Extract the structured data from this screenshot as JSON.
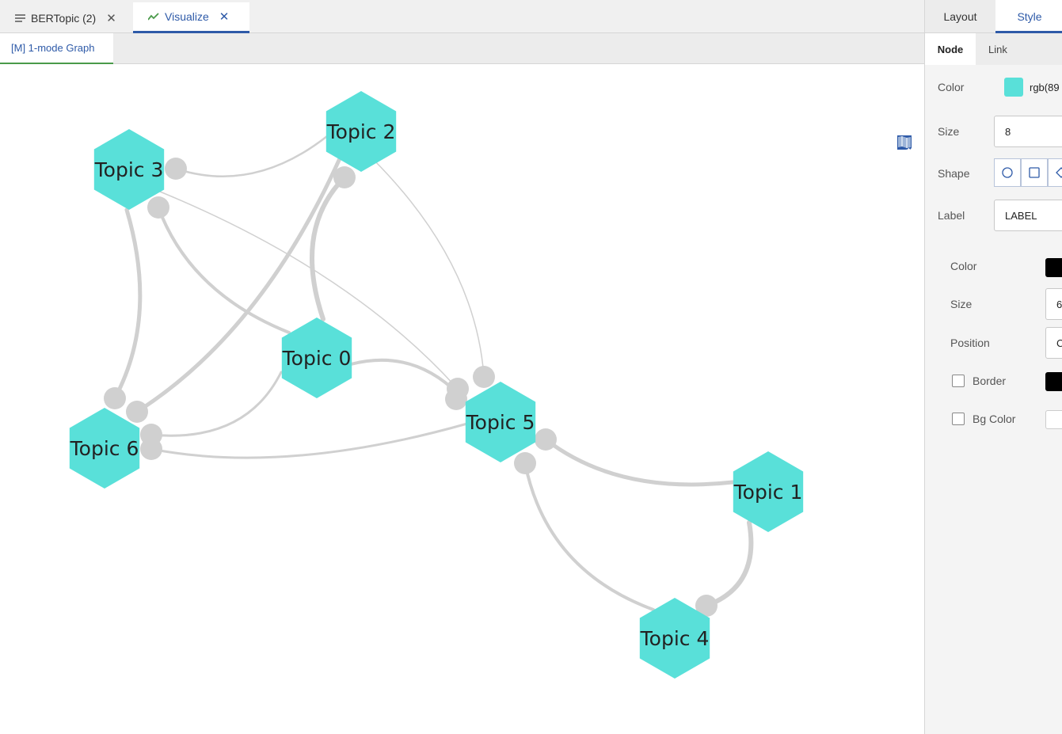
{
  "tabs": [
    {
      "label": "BERTopic (2)",
      "icon": "list-icon"
    },
    {
      "label": "Visualize",
      "icon": "trend-icon"
    }
  ],
  "subtab": {
    "label": "[M] 1-mode Graph"
  },
  "graph": {
    "node_color": "#59e0d9",
    "nodes": [
      "Topic 2",
      "Topic 3",
      "Topic 0",
      "Topic 5",
      "Topic 6",
      "Topic 1",
      "Topic 4"
    ]
  },
  "toolbar": {
    "icons": [
      "fit-screen-icon",
      "zoom-in-icon",
      "zoom-out-icon",
      "text-icon",
      "text-color-icon",
      "arrow-right-icon",
      "swap-horizontal-icon",
      "swap-vertical-icon",
      "copy-icon",
      "image-icon",
      "map-icon"
    ]
  },
  "panel": {
    "tabs": {
      "layout": "Layout",
      "style": "Style"
    },
    "subtabs": {
      "node": "Node",
      "link": "Link"
    },
    "color_label": "Color",
    "color_value": "rgb(89",
    "size_label": "Size",
    "size_value": "8",
    "shape_label": "Shape",
    "label_label": "Label",
    "label_value": "LABEL",
    "label_section": {
      "color_label": "Color",
      "size_label": "Size",
      "size_value": "6",
      "position_label": "Position",
      "position_value": "C",
      "border_label": "Border",
      "bgcolor_label": "Bg Color"
    }
  }
}
